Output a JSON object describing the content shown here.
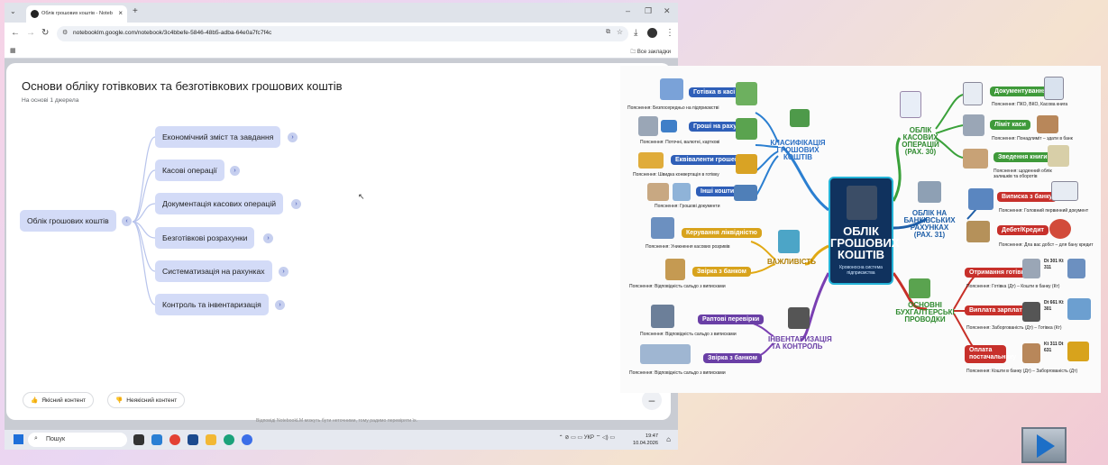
{
  "browser": {
    "tab_title": "Облік грошових коштів - Noteb",
    "url": "notebooklm.google.com/notebook/3c4bbefe-5846-48b5-adba-64e0a7fc7f4c",
    "bookmarks_label": "Все закладки"
  },
  "notebook": {
    "title": "Основи обліку готівкових та безготівкових грошових коштів",
    "subtitle": "На основі 1 джерела",
    "root_node": "Облік грошових коштів",
    "branches": [
      "Економічний зміст та завдання",
      "Касові операції",
      "Документація касових операцій",
      "Безготівкові розрахунки",
      "Систематизація на рахунках",
      "Контроль та інвентаризація"
    ],
    "good_label": "Якісний контент",
    "bad_label": "Неякісний контент",
    "disclaimer": "Відповіді NotebookLM можуть бути неточними, тому радимо перевіряти їх."
  },
  "taskbar": {
    "search_label": "Пошук",
    "lang": "УКР",
    "time": "19:47",
    "date": "10.04.2026"
  },
  "mindmap": {
    "center_title": "ОБЛІК ГРОШОВИХ КОШТІВ",
    "center_sub": "Кровоносна система підприємства",
    "cat_classification": "КЛАСИФІКАЦІЯ ГРОШОВИХ КОШТІВ",
    "cat_importance": "ВАЖЛИВІСТЬ",
    "cat_inventory": "ІНВЕНТАРИЗАЦІЯ ТА КОНТРОЛЬ",
    "cat_cash": "ОБЛІК КАСОВИХ ОПЕРАЦІЙ (РАХ. 30)",
    "cat_bank": "ОБЛІК НА БАНКІВСЬКИХ РАХУНКАХ (РАХ. 31)",
    "cat_entries": "ОСНОВНІ БУХГАЛТЕРСЬКІ ПРОВОДКИ",
    "left_items": [
      {
        "label": "Готівка в касі",
        "note": "Пояснення: Безпосередньо на підприємстві"
      },
      {
        "label": "Гроші на рахунках",
        "note": "Пояснення: Поточні, валютні, карткові"
      },
      {
        "label": "Еквіваленти грошей",
        "note": "Пояснення: Швидка конвертація в готівку"
      },
      {
        "label": "Інші кошти",
        "note": "Пояснення: Грошові документи"
      },
      {
        "label": "Керування ліквідністю",
        "note": "Пояснення: Уникнення касових розривів"
      },
      {
        "label": "Звірка з банком",
        "note": "Пояснення: Відповідність сальдо з виписками"
      },
      {
        "label": "Раптові перевірки",
        "note": "Пояснення: Відповідність сальдо з виписками"
      },
      {
        "label": "Звірка з банком",
        "note": "Пояснення: Відповідність сальдо з виписками"
      }
    ],
    "right_items": [
      {
        "label": "Документування",
        "note": "Пояснення: ПКО, ВКО, Касова книга"
      },
      {
        "label": "Ліміт каси",
        "note": "Пояснення: Понадлиміт – здати в банк"
      },
      {
        "label": "Зведення книги",
        "note": "Пояснення: щоденний облік залишків та оборотів"
      },
      {
        "label": "Виписка з банку",
        "note": "Пояснення: Головний первинний документ"
      },
      {
        "label": "Дебет/Кредит",
        "note": "Пояснення: Дла вас добст – для бану кредит"
      },
      {
        "label": "Отримання готівки",
        "note": "Пояснення: Готівка (Дт) – Кошти в банку (Кт)",
        "codes": "Dt 301 Kt 311"
      },
      {
        "label": "Виплата зарплати",
        "note": "Пояснення: Заборгованість (Дт) – Готівка (Кт)",
        "codes": "Dt 661 Kt 301"
      },
      {
        "label": "Оплата постачальнику",
        "note": "Пояснення: Кошти в банку (Дт) – Заборгованість (Дт)",
        "codes": "Kt 311 Dt 631"
      }
    ]
  },
  "colors": {
    "node_bg": "#d3dbf7",
    "blue_label": "#2f5fb8",
    "gold_label": "#d8a31c",
    "purple_label": "#6a3fa6",
    "green_label": "#3f9a3a",
    "red_label": "#c7302b",
    "center_bg": "#10325e"
  }
}
